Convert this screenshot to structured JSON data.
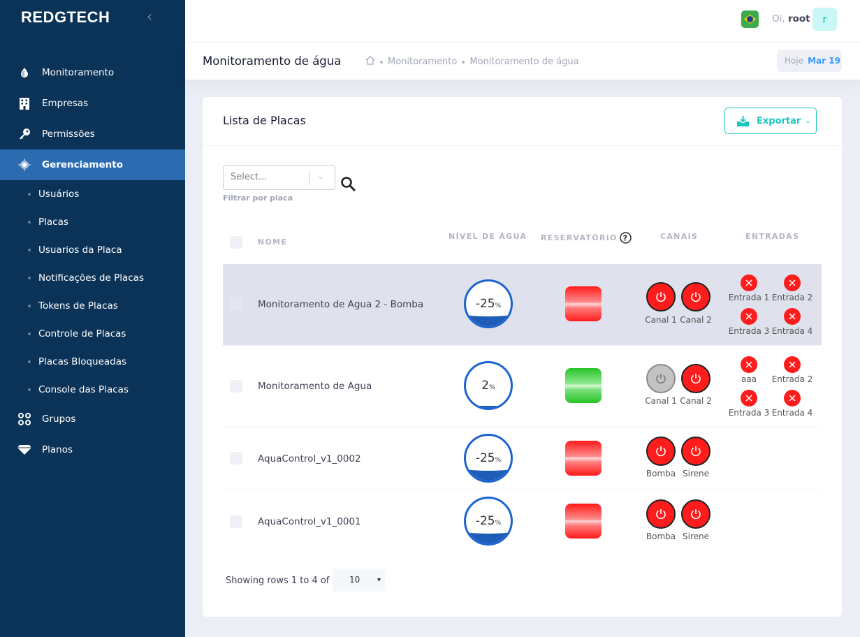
{
  "brand": "REDGTECH",
  "sidebar": {
    "items": [
      {
        "label": "Monitoramento",
        "icon": "water-drop-icon"
      },
      {
        "label": "Empresas",
        "icon": "building-icon"
      },
      {
        "label": "Permissões",
        "icon": "key-icon"
      },
      {
        "label": "Gerenciamento",
        "icon": "gear-icon",
        "active": true
      },
      {
        "label": "Grupos",
        "icon": "circles-icon"
      },
      {
        "label": "Planos",
        "icon": "diamond-icon"
      }
    ],
    "subitems": [
      "Usuários",
      "Placas",
      "Usuarios da Placa",
      "Notificações de Placas",
      "Tokens de Placas",
      "Controle de Placas",
      "Placas Bloqueadas",
      "Console das Placas"
    ]
  },
  "header": {
    "greeting": "Oi,",
    "user": "root",
    "avatar_letter": "r",
    "flag": "brazil-flag-icon"
  },
  "toolbar": {
    "title": "Monitoramento de água",
    "breadcrumb": [
      "Monitoramento",
      "Monitoramento de água"
    ],
    "date_label": "Hoje",
    "date_value": "Mar 19"
  },
  "card": {
    "title": "Lista de Placas",
    "export_label": "Exportar",
    "filter_placeholder": "Select...",
    "filter_help": "Filtrar por placa"
  },
  "table": {
    "headers": {
      "name": "NOME",
      "level": "NÍVEL DE ÁGUA",
      "reservoir": "RESERVATÓRIO",
      "channels": "CANAIS",
      "inputs": "ENTRADAS"
    },
    "rows": [
      {
        "name": "Monitoramento de Agua 2 - Bomba",
        "level": "-25",
        "unit": "%",
        "level_fill": 0.25,
        "reservoir": "red",
        "channels": [
          {
            "label": "Canal 1",
            "on": true
          },
          {
            "label": "Canal 2",
            "on": true
          }
        ],
        "inputs": [
          "Entrada 1",
          "Entrada 2",
          "Entrada 3",
          "Entrada 4"
        ]
      },
      {
        "name": "Monitoramento de Agua",
        "level": "2",
        "unit": "%",
        "level_fill": 0.02,
        "reservoir": "green",
        "channels": [
          {
            "label": "Canal 1",
            "on": false
          },
          {
            "label": "Canal 2",
            "on": true
          }
        ],
        "inputs": [
          "aaa",
          "Entrada 2",
          "Entrada 3",
          "Entrada 4"
        ]
      },
      {
        "name": "AquaControl_v1_0002",
        "level": "-25",
        "unit": "%",
        "level_fill": 0.25,
        "reservoir": "red",
        "channels": [
          {
            "label": "Bomba",
            "on": true
          },
          {
            "label": "Sirene",
            "on": true
          }
        ],
        "inputs": []
      },
      {
        "name": "AquaControl_v1_0001",
        "level": "-25",
        "unit": "%",
        "level_fill": 0.25,
        "reservoir": "red",
        "channels": [
          {
            "label": "Bomba",
            "on": true
          },
          {
            "label": "Sirene",
            "on": true
          }
        ],
        "inputs": []
      }
    ]
  },
  "footer": {
    "showing": "Showing rows 1 to 4 of 4",
    "page_size": "10"
  }
}
